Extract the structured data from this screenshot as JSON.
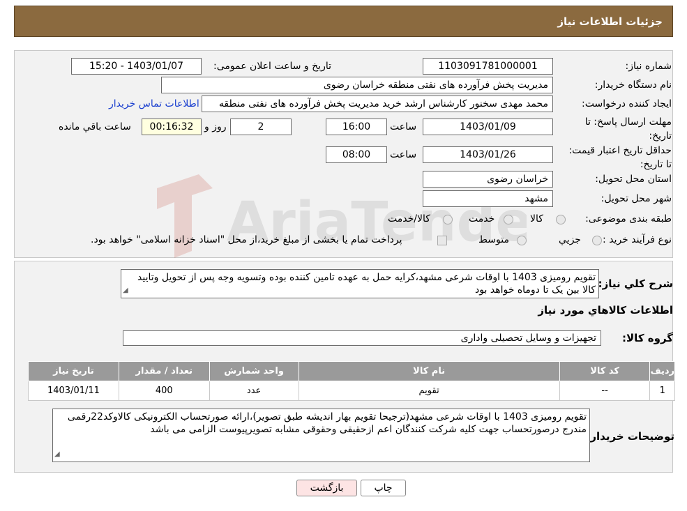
{
  "header": {
    "title": "جزئیات اطلاعات نیاز"
  },
  "labels": {
    "need_number": "شماره نیاز:",
    "announce_datetime": "تاریخ و ساعت اعلان عمومی:",
    "buyer_org": "نام دستگاه خریدار:",
    "requester": "ایجاد کننده درخواست:",
    "reply_deadline": "مهلت ارسال پاسخ: تا تاریخ:",
    "hour": "ساعت",
    "day_and": "روز و",
    "remaining": "ساعت باقي مانده",
    "price_validity": "حداقل تاریخ اعتبار قیمت: تا تاریخ:",
    "province": "استان محل تحویل:",
    "city": "شهر محل تحویل:",
    "category": "طبقه بندی موضوعی:",
    "purchase_type": "نوع فرآیند خرید :",
    "general_desc": "شرح كلي نياز:",
    "goods_info": "اطلاعات كالاهاي مورد نياز",
    "goods_group": "گروه کالا:",
    "buyer_notes": "توضیحات خریدار:"
  },
  "values": {
    "need_number": "1103091781000001",
    "announce_datetime": "1403/01/07 - 15:20",
    "buyer_org": "مدیریت پخش فرآورده های نفتی منطقه خراسان رضوی",
    "requester": "محمد مهدی سخنور کارشناس ارشد خرید مدیریت پخش فرآورده های نفتی منطقه",
    "contact_link": "اطلاعات تماس خریدار",
    "reply_date": "1403/01/09",
    "reply_time": "16:00",
    "days": "2",
    "countdown": "00:16:32",
    "validity_date": "1403/01/26",
    "validity_time": "08:00",
    "province": "خراسان رضوی",
    "city": "مشهد",
    "general_desc": "تقویم رومیزی 1403 با اوقات شرعی مشهد،کرایه حمل به عهده تامین کننده بوده وتسویه وجه پس از تحویل وتایید کالا بین یک تا دوماه خواهد بود",
    "goods_group": "تجهیزات و وسایل تحصیلی واداری",
    "buyer_notes": "تقویم رومیزی 1403 با اوقات شرعی مشهد(ترجیحا تقویم بهار اندیشه طبق تصویر)،ارائه صورتحساب الکترونیکی کالاوکد22رقمی مندرج درصورتحساب جهت کلیه شرکت کنندگان اعم ازحقیقی وحقوقی مشابه تصویرپیوست الزامی می باشد"
  },
  "category_options": [
    "کالا",
    "خدمت",
    "کالا/خدمت"
  ],
  "purchase_options": [
    "جزيي",
    "متوسط"
  ],
  "purchase_note": "پرداخت تمام یا بخشی از مبلغ خرید،از محل \"اسناد خزانه اسلامی\" خواهد بود.",
  "table": {
    "headers": [
      "رديف",
      "کد کالا",
      "نام کالا",
      "واحد شمارش",
      "تعداد / مقدار",
      "تاریخ نیاز"
    ],
    "rows": [
      [
        "1",
        "--",
        "تقویم",
        "عدد",
        "400",
        "1403/01/11"
      ]
    ]
  },
  "buttons": {
    "print": "چاپ",
    "back": "بازگشت"
  },
  "watermark": {
    "text": "AriaTender.neT"
  },
  "colors": {
    "header": "#8b6a3f",
    "link": "#1a3fcf",
    "back_button": "#fde4e4",
    "print_button": "#ffffff"
  }
}
